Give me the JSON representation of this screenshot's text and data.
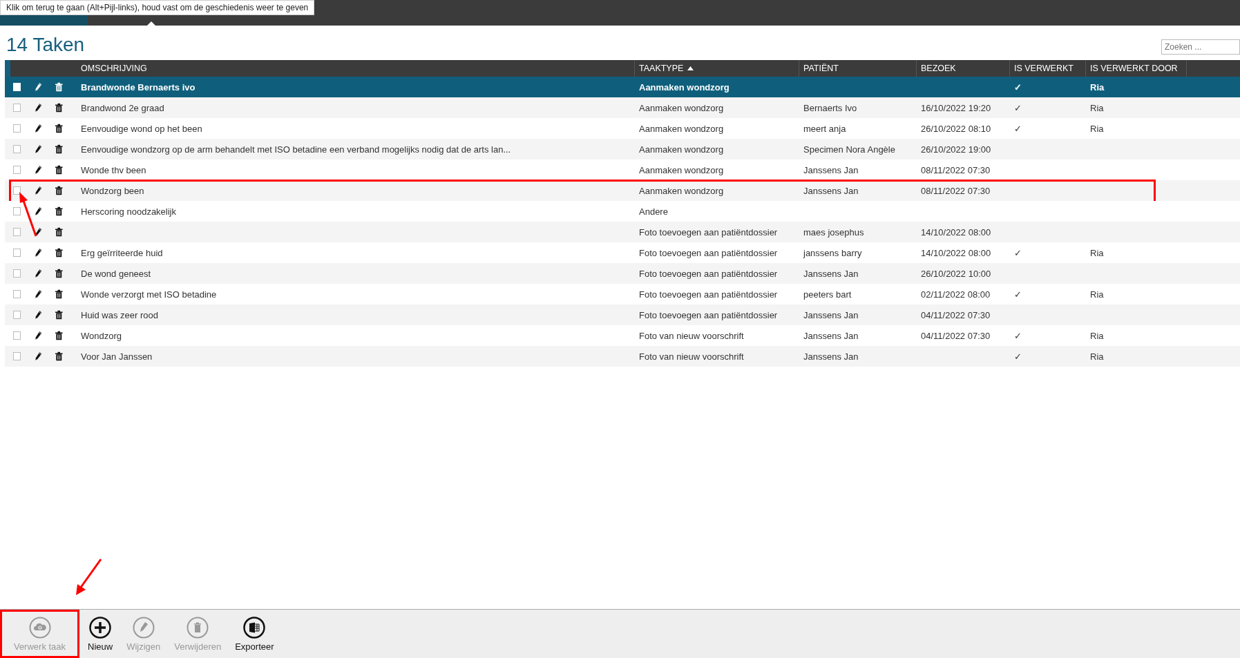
{
  "tooltip": "Klik om terug te gaan (Alt+Pijl-links), houd vast om de geschiedenis weer te geven",
  "title": "14 Taken",
  "search": {
    "placeholder": "Zoeken ..."
  },
  "columns": [
    {
      "label": "OMSCHRIJVING",
      "sorted": false
    },
    {
      "label": "TAAKTYPE",
      "sorted": true
    },
    {
      "label": "PATIËNT",
      "sorted": false
    },
    {
      "label": "BEZOEK",
      "sorted": false
    },
    {
      "label": "IS VERWERKT",
      "sorted": false
    },
    {
      "label": "IS VERWERKT DOOR",
      "sorted": false
    }
  ],
  "rows": [
    {
      "selected": true,
      "highlighted": false,
      "cells": [
        "Brandwonde Bernaerts ivo",
        "Aanmaken wondzorg",
        "",
        "",
        "✓",
        "Ria"
      ]
    },
    {
      "selected": false,
      "highlighted": false,
      "cells": [
        "Brandwond 2e graad",
        "Aanmaken wondzorg",
        "Bernaerts Ivo",
        "16/10/2022 19:20",
        "✓",
        "Ria"
      ]
    },
    {
      "selected": false,
      "highlighted": false,
      "cells": [
        "Eenvoudige wond op het been",
        "Aanmaken wondzorg",
        "meert anja",
        "26/10/2022 08:10",
        "✓",
        "Ria"
      ]
    },
    {
      "selected": false,
      "highlighted": false,
      "cells": [
        "Eenvoudige wondzorg op de arm behandelt met ISO betadine een verband mogelijks nodig dat de arts lan...",
        "Aanmaken wondzorg",
        "Specimen Nora Angèle",
        "26/10/2022 19:00",
        "",
        ""
      ]
    },
    {
      "selected": false,
      "highlighted": false,
      "cells": [
        "Wonde thv been",
        "Aanmaken wondzorg",
        "Janssens Jan",
        "08/11/2022 07:30",
        "",
        ""
      ]
    },
    {
      "selected": false,
      "highlighted": true,
      "cells": [
        "Wondzorg been",
        "Aanmaken wondzorg",
        "Janssens Jan",
        "08/11/2022 07:30",
        "",
        ""
      ]
    },
    {
      "selected": false,
      "highlighted": false,
      "cells": [
        "Herscoring noodzakelijk",
        "Andere",
        "",
        "",
        "",
        ""
      ]
    },
    {
      "selected": false,
      "highlighted": false,
      "cells": [
        "",
        "Foto toevoegen aan patiëntdossier",
        "maes josephus",
        "14/10/2022 08:00",
        "",
        ""
      ]
    },
    {
      "selected": false,
      "highlighted": false,
      "cells": [
        "Erg geïrriteerde huid",
        "Foto toevoegen aan patiëntdossier",
        "janssens barry",
        "14/10/2022 08:00",
        "✓",
        "Ria"
      ]
    },
    {
      "selected": false,
      "highlighted": false,
      "cells": [
        "De wond geneest",
        "Foto toevoegen aan patiëntdossier",
        "Janssens Jan",
        "26/10/2022 10:00",
        "",
        ""
      ]
    },
    {
      "selected": false,
      "highlighted": false,
      "cells": [
        "Wonde verzorgt met ISO betadine",
        "Foto toevoegen aan patiëntdossier",
        "peeters bart",
        "02/11/2022 08:00",
        "✓",
        "Ria"
      ]
    },
    {
      "selected": false,
      "highlighted": false,
      "cells": [
        "Huid was zeer rood",
        "Foto toevoegen aan patiëntdossier",
        "Janssens Jan",
        "04/11/2022 07:30",
        "",
        ""
      ]
    },
    {
      "selected": false,
      "highlighted": false,
      "cells": [
        "Wondzorg",
        "Foto van nieuw voorschrift",
        "Janssens Jan",
        "04/11/2022 07:30",
        "✓",
        "Ria"
      ]
    },
    {
      "selected": false,
      "highlighted": false,
      "cells": [
        "Voor Jan Janssen",
        "Foto van nieuw voorschrift",
        "Janssens Jan",
        "",
        "✓",
        "Ria"
      ]
    }
  ],
  "toolbar": [
    {
      "kind": "process",
      "label": "Verwerk taak",
      "disabled": true,
      "highlighted": true
    },
    {
      "kind": "new",
      "label": "Nieuw",
      "disabled": false,
      "highlighted": false
    },
    {
      "kind": "edit",
      "label": "Wijzigen",
      "disabled": true,
      "highlighted": false
    },
    {
      "kind": "delete",
      "label": "Verwijderen",
      "disabled": true,
      "highlighted": false
    },
    {
      "kind": "export",
      "label": "Exporteer",
      "disabled": false,
      "highlighted": false
    }
  ]
}
